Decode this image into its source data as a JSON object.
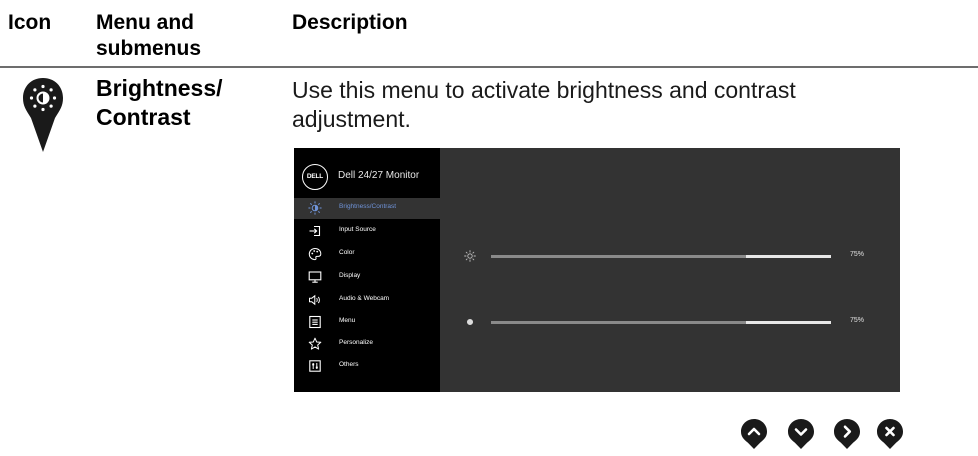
{
  "header": {
    "icon": "Icon",
    "menu": "Menu and submenus",
    "description": "Description"
  },
  "row": {
    "icon": "brightness-pin-icon",
    "name": "Brightness/ Contrast",
    "description": "Use this menu to activate brightness and contrast adjustment."
  },
  "osd": {
    "brand": "DELL",
    "title": "Dell 24/27 Monitor",
    "menu": [
      {
        "label": "Brightness/Contrast",
        "icon": "brightness-icon",
        "active": true
      },
      {
        "label": "Input Source",
        "icon": "input-source-icon"
      },
      {
        "label": "Color",
        "icon": "color-palette-icon"
      },
      {
        "label": "Display",
        "icon": "display-icon"
      },
      {
        "label": "Audio & Webcam",
        "icon": "speaker-icon"
      },
      {
        "label": "Menu",
        "icon": "menu-icon"
      },
      {
        "label": "Personalize",
        "icon": "star-icon"
      },
      {
        "label": "Others",
        "icon": "others-icon"
      }
    ],
    "brightness": {
      "icon": "sun-icon",
      "value_label": "75%",
      "value": 0.75
    },
    "contrast": {
      "icon": "contrast-icon",
      "value_label": "75%",
      "value": 0.75
    },
    "accent_color": "#6f93d8"
  },
  "nav_buttons": [
    {
      "name": "up-button",
      "icon": "chevron-up-icon"
    },
    {
      "name": "down-button",
      "icon": "chevron-down-icon"
    },
    {
      "name": "right-button",
      "icon": "chevron-right-icon"
    },
    {
      "name": "close-button",
      "icon": "close-icon"
    }
  ]
}
